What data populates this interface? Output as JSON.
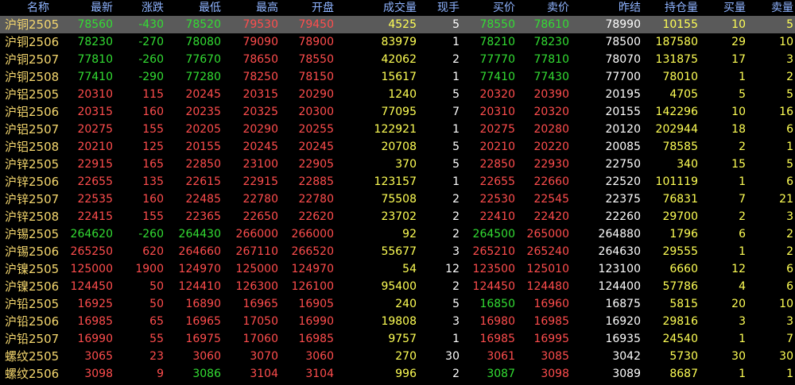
{
  "colors": {
    "up": "#ff4d4d",
    "down": "#33dd33",
    "flat": "#ffffff",
    "name": "#f5d76e",
    "vol": "#ffff55",
    "header": "#8fb4ff",
    "selected_bg": "#5a5a5a"
  },
  "columns": [
    {
      "key": "name",
      "label": "名称"
    },
    {
      "key": "latest",
      "label": "最新"
    },
    {
      "key": "change",
      "label": "涨跌"
    },
    {
      "key": "low",
      "label": "最低"
    },
    {
      "key": "high",
      "label": "最高"
    },
    {
      "key": "open",
      "label": "开盘"
    },
    {
      "key": "volume",
      "label": "成交量"
    },
    {
      "key": "cur",
      "label": "现手"
    },
    {
      "key": "bid",
      "label": "买价"
    },
    {
      "key": "ask",
      "label": "卖价"
    },
    {
      "key": "prev",
      "label": "昨结"
    },
    {
      "key": "oi",
      "label": "持仓量"
    },
    {
      "key": "bidq",
      "label": "买量"
    },
    {
      "key": "askq",
      "label": "卖量"
    }
  ],
  "rows": [
    {
      "name": "沪铜2505",
      "latest": "78560",
      "change": "-430",
      "low": "78520",
      "high": "79530",
      "open": "79450",
      "volume": "4525",
      "cur": "5",
      "bid": "78550",
      "ask": "78610",
      "prev": "78990",
      "oi": "10155",
      "bidq": "10",
      "askq": "5",
      "selected": true
    },
    {
      "name": "沪铜2506",
      "latest": "78230",
      "change": "-270",
      "low": "78080",
      "high": "79090",
      "open": "78900",
      "volume": "83979",
      "cur": "1",
      "bid": "78210",
      "ask": "78230",
      "prev": "78500",
      "oi": "187580",
      "bidq": "29",
      "askq": "10"
    },
    {
      "name": "沪铜2507",
      "latest": "77810",
      "change": "-260",
      "low": "77670",
      "high": "78650",
      "open": "78550",
      "volume": "42062",
      "cur": "2",
      "bid": "77770",
      "ask": "77810",
      "prev": "78070",
      "oi": "131875",
      "bidq": "17",
      "askq": "3"
    },
    {
      "name": "沪铜2508",
      "latest": "77410",
      "change": "-290",
      "low": "77280",
      "high": "78250",
      "open": "78150",
      "volume": "15617",
      "cur": "1",
      "bid": "77410",
      "ask": "77430",
      "prev": "77700",
      "oi": "78010",
      "bidq": "1",
      "askq": "2"
    },
    {
      "name": "沪铝2505",
      "latest": "20310",
      "change": "115",
      "low": "20245",
      "high": "20315",
      "open": "20290",
      "volume": "1240",
      "cur": "5",
      "bid": "20320",
      "ask": "20390",
      "prev": "20195",
      "oi": "4705",
      "bidq": "5",
      "askq": "5"
    },
    {
      "name": "沪铝2506",
      "latest": "20315",
      "change": "160",
      "low": "20235",
      "high": "20325",
      "open": "20300",
      "volume": "77095",
      "cur": "7",
      "bid": "20310",
      "ask": "20320",
      "prev": "20155",
      "oi": "142296",
      "bidq": "10",
      "askq": "16"
    },
    {
      "name": "沪铝2507",
      "latest": "20275",
      "change": "155",
      "low": "20205",
      "high": "20290",
      "open": "20255",
      "volume": "122921",
      "cur": "1",
      "bid": "20275",
      "ask": "20280",
      "prev": "20120",
      "oi": "202944",
      "bidq": "18",
      "askq": "6"
    },
    {
      "name": "沪铝2508",
      "latest": "20210",
      "change": "125",
      "low": "20155",
      "high": "20245",
      "open": "20245",
      "volume": "20708",
      "cur": "5",
      "bid": "20210",
      "ask": "20220",
      "prev": "20085",
      "oi": "78585",
      "bidq": "2",
      "askq": "1"
    },
    {
      "name": "沪锌2505",
      "latest": "22915",
      "change": "165",
      "low": "22850",
      "high": "23100",
      "open": "22905",
      "volume": "370",
      "cur": "5",
      "bid": "22850",
      "ask": "22930",
      "prev": "22750",
      "oi": "340",
      "bidq": "15",
      "askq": "5"
    },
    {
      "name": "沪锌2506",
      "latest": "22655",
      "change": "135",
      "low": "22615",
      "high": "22915",
      "open": "22885",
      "volume": "123157",
      "cur": "1",
      "bid": "22655",
      "ask": "22660",
      "prev": "22520",
      "oi": "101119",
      "bidq": "1",
      "askq": "6"
    },
    {
      "name": "沪锌2507",
      "latest": "22535",
      "change": "160",
      "low": "22485",
      "high": "22780",
      "open": "22780",
      "volume": "75508",
      "cur": "2",
      "bid": "22530",
      "ask": "22545",
      "prev": "22375",
      "oi": "76831",
      "bidq": "7",
      "askq": "21"
    },
    {
      "name": "沪锌2508",
      "latest": "22415",
      "change": "155",
      "low": "22365",
      "high": "22650",
      "open": "22620",
      "volume": "23702",
      "cur": "2",
      "bid": "22410",
      "ask": "22420",
      "prev": "22260",
      "oi": "29700",
      "bidq": "2",
      "askq": "3"
    },
    {
      "name": "沪锡2505",
      "latest": "264620",
      "change": "-260",
      "low": "264430",
      "high": "266000",
      "open": "266000",
      "volume": "92",
      "cur": "2",
      "bid": "264500",
      "ask": "265000",
      "prev": "264880",
      "oi": "1796",
      "bidq": "6",
      "askq": "2"
    },
    {
      "name": "沪锡2506",
      "latest": "265250",
      "change": "620",
      "low": "264660",
      "high": "267110",
      "open": "266520",
      "volume": "55677",
      "cur": "3",
      "bid": "265210",
      "ask": "265240",
      "prev": "264630",
      "oi": "29555",
      "bidq": "1",
      "askq": "2"
    },
    {
      "name": "沪镍2505",
      "latest": "125000",
      "change": "1900",
      "low": "124970",
      "high": "125000",
      "open": "124970",
      "volume": "54",
      "cur": "12",
      "bid": "123500",
      "ask": "125010",
      "prev": "123100",
      "oi": "6660",
      "bidq": "12",
      "askq": "6"
    },
    {
      "name": "沪镍2506",
      "latest": "124450",
      "change": "50",
      "low": "124410",
      "high": "126300",
      "open": "126100",
      "volume": "95400",
      "cur": "2",
      "bid": "124450",
      "ask": "124480",
      "prev": "124400",
      "oi": "57786",
      "bidq": "4",
      "askq": "6"
    },
    {
      "name": "沪铅2505",
      "latest": "16925",
      "change": "50",
      "low": "16890",
      "high": "16965",
      "open": "16905",
      "volume": "240",
      "cur": "5",
      "bid": "16850",
      "ask": "16960",
      "prev": "16875",
      "oi": "5815",
      "bidq": "20",
      "askq": "10"
    },
    {
      "name": "沪铅2506",
      "latest": "16985",
      "change": "65",
      "low": "16965",
      "high": "17050",
      "open": "16990",
      "volume": "19808",
      "cur": "3",
      "bid": "16980",
      "ask": "16985",
      "prev": "16920",
      "oi": "29816",
      "bidq": "3",
      "askq": "3"
    },
    {
      "name": "沪铅2507",
      "latest": "16990",
      "change": "55",
      "low": "16975",
      "high": "17060",
      "open": "16985",
      "volume": "9757",
      "cur": "1",
      "bid": "16985",
      "ask": "16995",
      "prev": "16935",
      "oi": "24540",
      "bidq": "1",
      "askq": "7"
    },
    {
      "name": "螺纹2505",
      "latest": "3065",
      "change": "23",
      "low": "3060",
      "high": "3070",
      "open": "3060",
      "volume": "270",
      "cur": "30",
      "bid": "3061",
      "ask": "3085",
      "prev": "3042",
      "oi": "5730",
      "bidq": "30",
      "askq": "30"
    },
    {
      "name": "螺纹2506",
      "latest": "3098",
      "change": "9",
      "low": "3086",
      "high": "3104",
      "open": "3104",
      "volume": "996",
      "cur": "2",
      "bid": "3087",
      "ask": "3098",
      "prev": "3089",
      "oi": "8687",
      "bidq": "1",
      "askq": "1"
    }
  ]
}
